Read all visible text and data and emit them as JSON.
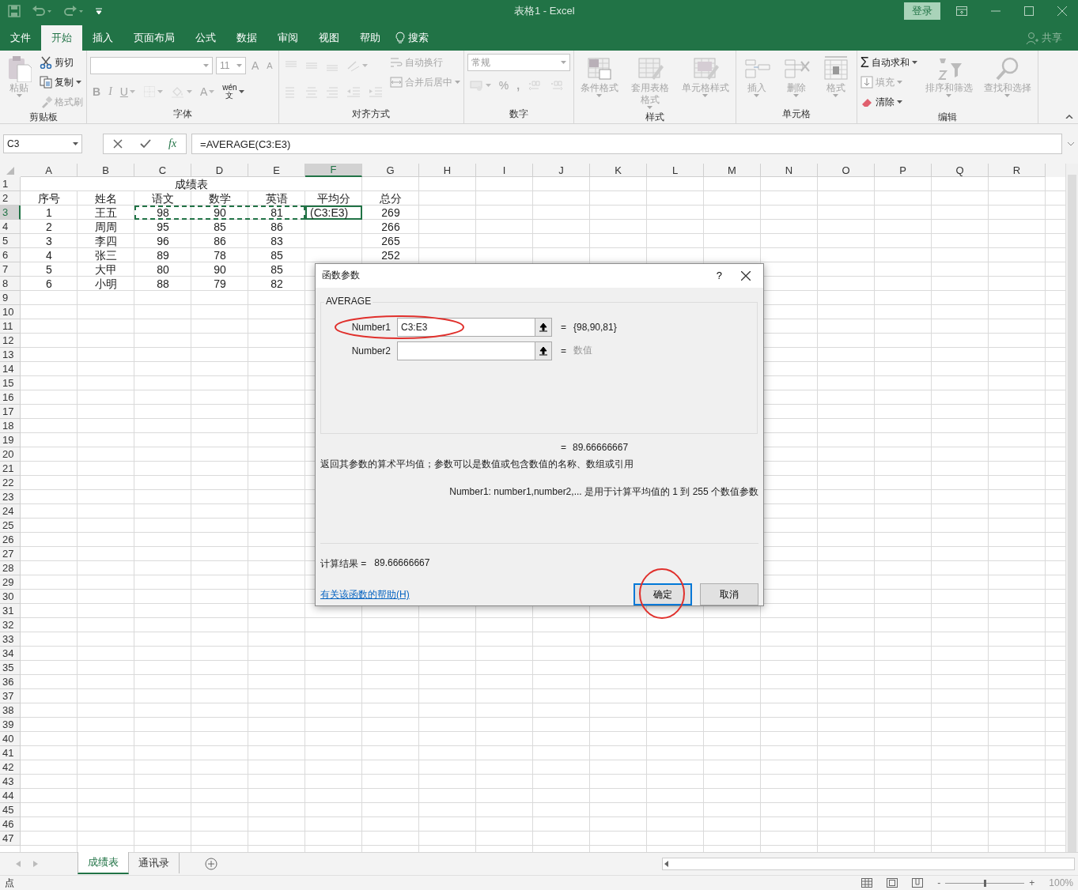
{
  "window": {
    "title": "表格1  -  Excel",
    "login_button": "登录"
  },
  "menu": {
    "tabs": [
      {
        "label": "文件",
        "selected": false
      },
      {
        "label": "开始",
        "selected": true
      },
      {
        "label": "插入",
        "selected": false
      },
      {
        "label": "页面布局",
        "selected": false
      },
      {
        "label": "公式",
        "selected": false
      },
      {
        "label": "数据",
        "selected": false
      },
      {
        "label": "审阅",
        "selected": false
      },
      {
        "label": "视图",
        "selected": false
      },
      {
        "label": "帮助",
        "selected": false
      }
    ],
    "search": "搜索",
    "share": "共享"
  },
  "ribbon": {
    "groups": [
      {
        "label": "剪贴板",
        "sections": [
          [
            {
              "kind": "large",
              "label": "粘贴",
              "disabled": true,
              "caret": true
            }
          ],
          [
            {
              "kind": "small",
              "label": "剪切",
              "disabled": false,
              "caret": false
            },
            {
              "kind": "small",
              "label": "复制",
              "disabled": false,
              "caret": true
            },
            {
              "kind": "small",
              "label": "格式刷",
              "disabled": true,
              "caret": false
            }
          ]
        ]
      },
      {
        "label": "字体",
        "sections": [
          [
            {
              "kind": "row",
              "items": [
                {
                  "kind": "combo"
                },
                {
                  "kind": "combo",
                  "value": "11"
                },
                {
                  "kind": "glyph",
                  "text": "A",
                  "disabled": true,
                  "caret": false
                },
                {
                  "kind": "glyph",
                  "text": "A",
                  "disabled": true,
                  "caret": false
                }
              ]
            },
            {
              "kind": "row",
              "items": [
                {
                  "kind": "glyph",
                  "text": "B",
                  "disabled": true,
                  "caret": false
                },
                {
                  "kind": "glyph",
                  "text": "I",
                  "disabled": true,
                  "caret": false
                },
                {
                  "kind": "glyph",
                  "text": "U",
                  "disabled": true,
                  "caret": true
                },
                {
                  "kind": "icon",
                  "disabled": true,
                  "caret": true
                },
                {
                  "kind": "icon",
                  "disabled": true,
                  "caret": true
                },
                {
                  "kind": "glyph",
                  "text": "A",
                  "disabled": true,
                  "caret": true
                },
                {
                  "kind": "glyph",
                  "text": "wén\n文",
                  "disabled": false,
                  "caret": true
                }
              ]
            }
          ]
        ]
      },
      {
        "label": "对齐方式",
        "sections": [
          [
            {
              "kind": "row",
              "items": [
                {
                  "kind": "icon",
                  "disabled": true,
                  "caret": false
                },
                {
                  "kind": "icon",
                  "disabled": true,
                  "caret": false
                },
                {
                  "kind": "icon",
                  "disabled": true,
                  "caret": false
                },
                {
                  "kind": "icon",
                  "disabled": true,
                  "caret": true
                }
              ]
            },
            {
              "kind": "row",
              "items": [
                {
                  "kind": "icon",
                  "disabled": true,
                  "caret": false
                },
                {
                  "kind": "icon",
                  "disabled": true,
                  "caret": false
                },
                {
                  "kind": "icon",
                  "disabled": true,
                  "caret": false
                },
                {
                  "kind": "icon",
                  "disabled": true,
                  "caret": false
                },
                {
                  "kind": "icon",
                  "disabled": true,
                  "caret": false
                }
              ]
            }
          ],
          [
            {
              "kind": "small",
              "label": "自动换行",
              "disabled": true,
              "caret": false
            },
            {
              "kind": "small",
              "label": "合并后居中",
              "disabled": true,
              "caret": true
            }
          ]
        ]
      },
      {
        "label": "数字",
        "sections": [
          [
            {
              "kind": "combo",
              "value": "常规"
            },
            {
              "kind": "row",
              "items": [
                {
                  "kind": "icon",
                  "disabled": true,
                  "caret": true
                },
                {
                  "kind": "glyph",
                  "text": "%",
                  "disabled": true,
                  "caret": false
                },
                {
                  "kind": "glyph",
                  "text": ",",
                  "disabled": true,
                  "caret": false
                },
                {
                  "kind": "icon",
                  "disabled": true,
                  "caret": false
                },
                {
                  "kind": "icon",
                  "disabled": true,
                  "caret": false
                }
              ]
            }
          ]
        ]
      },
      {
        "label": "样式",
        "sections": [
          [
            {
              "kind": "large",
              "label": "条件格式",
              "disabled": true,
              "caret": true
            }
          ],
          [
            {
              "kind": "large",
              "label": "套用表格格式",
              "disabled": true,
              "caret": true
            }
          ],
          [
            {
              "kind": "large",
              "label": "单元格样式",
              "disabled": true,
              "caret": true
            }
          ]
        ]
      },
      {
        "label": "单元格",
        "sections": [
          [
            {
              "kind": "large",
              "label": "插入",
              "disabled": true,
              "caret": true
            }
          ],
          [
            {
              "kind": "large",
              "label": "删除",
              "disabled": true,
              "caret": true
            }
          ],
          [
            {
              "kind": "large",
              "label": "格式",
              "disabled": true,
              "caret": true
            }
          ]
        ]
      },
      {
        "label": "编辑",
        "sections": [
          [
            {
              "kind": "small",
              "symbol": "Σ",
              "label": "自动求和",
              "disabled": false,
              "caret": true
            },
            {
              "kind": "small",
              "label": "填充",
              "disabled": true,
              "caret": true
            },
            {
              "kind": "small",
              "label": "清除",
              "disabled": false,
              "caret": true
            }
          ],
          [
            {
              "kind": "large",
              "label": "排序和筛选",
              "disabled": true,
              "caret": true
            }
          ],
          [
            {
              "kind": "large",
              "label": "查找和选择",
              "disabled": true,
              "caret": true
            }
          ]
        ]
      }
    ]
  },
  "formula_bar": {
    "name_box": "C3",
    "function_button": "fx",
    "formula": "=AVERAGE(C3:E3)"
  },
  "sheet": {
    "columns": [
      {
        "label": "A",
        "selected": false
      },
      {
        "label": "B",
        "selected": false
      },
      {
        "label": "C",
        "selected": false
      },
      {
        "label": "D",
        "selected": false
      },
      {
        "label": "E",
        "selected": false
      },
      {
        "label": "F",
        "selected": true
      },
      {
        "label": "G",
        "selected": false
      },
      {
        "label": "H",
        "selected": false
      },
      {
        "label": "I",
        "selected": false
      },
      {
        "label": "J",
        "selected": false
      },
      {
        "label": "K",
        "selected": false
      },
      {
        "label": "L",
        "selected": false
      },
      {
        "label": "M",
        "selected": false
      },
      {
        "label": "N",
        "selected": false
      },
      {
        "label": "O",
        "selected": false
      },
      {
        "label": "P",
        "selected": false
      },
      {
        "label": "Q",
        "selected": false
      },
      {
        "label": "R",
        "selected": false
      }
    ],
    "row_headers": [
      {
        "label": "1",
        "selected": false
      },
      {
        "label": "2",
        "selected": false
      },
      {
        "label": "3",
        "selected": true
      },
      {
        "label": "4",
        "selected": false
      },
      {
        "label": "5",
        "selected": false
      },
      {
        "label": "6",
        "selected": false
      },
      {
        "label": "7",
        "selected": false
      },
      {
        "label": "8",
        "selected": false
      },
      {
        "label": "9",
        "selected": false
      },
      {
        "label": "10",
        "selected": false
      },
      {
        "label": "11",
        "selected": false
      },
      {
        "label": "12",
        "selected": false
      },
      {
        "label": "13",
        "selected": false
      },
      {
        "label": "14",
        "selected": false
      },
      {
        "label": "15",
        "selected": false
      },
      {
        "label": "16",
        "selected": false
      },
      {
        "label": "17",
        "selected": false
      },
      {
        "label": "18",
        "selected": false
      },
      {
        "label": "19",
        "selected": false
      },
      {
        "label": "20",
        "selected": false
      },
      {
        "label": "21",
        "selected": false
      },
      {
        "label": "22",
        "selected": false
      },
      {
        "label": "23",
        "selected": false
      },
      {
        "label": "24",
        "selected": false
      },
      {
        "label": "25",
        "selected": false
      },
      {
        "label": "26",
        "selected": false
      },
      {
        "label": "27",
        "selected": false
      },
      {
        "label": "28",
        "selected": false
      },
      {
        "label": "29",
        "selected": false
      },
      {
        "label": "30",
        "selected": false
      },
      {
        "label": "31",
        "selected": false
      },
      {
        "label": "32",
        "selected": false
      },
      {
        "label": "33",
        "selected": false
      },
      {
        "label": "34",
        "selected": false
      },
      {
        "label": "35",
        "selected": false
      },
      {
        "label": "36",
        "selected": false
      },
      {
        "label": "37",
        "selected": false
      },
      {
        "label": "38",
        "selected": false
      },
      {
        "label": "39",
        "selected": false
      },
      {
        "label": "40",
        "selected": false
      },
      {
        "label": "41",
        "selected": false
      },
      {
        "label": "42",
        "selected": false
      },
      {
        "label": "43",
        "selected": false
      },
      {
        "label": "44",
        "selected": false
      },
      {
        "label": "45",
        "selected": false
      },
      {
        "label": "46",
        "selected": false
      },
      {
        "label": "47",
        "selected": false
      }
    ],
    "title": "成绩表",
    "header": [
      "序号",
      "姓名",
      "语文",
      "数学",
      "英语",
      "平均分",
      "总分"
    ],
    "rows": [
      {
        "cells": [
          "1",
          "王五",
          "98",
          "90",
          "81",
          "(C3:E3)",
          "269"
        ],
        "referenced": true,
        "editing": true
      },
      {
        "cells": [
          "2",
          "周周",
          "95",
          "85",
          "86",
          "",
          "266"
        ],
        "referenced": false,
        "editing": false
      },
      {
        "cells": [
          "3",
          "李四",
          "96",
          "86",
          "83",
          "",
          "265"
        ],
        "referenced": false,
        "editing": false
      },
      {
        "cells": [
          "4",
          "张三",
          "89",
          "78",
          "85",
          "",
          "252"
        ],
        "referenced": false,
        "editing": false
      },
      {
        "cells": [
          "5",
          "大甲",
          "80",
          "90",
          "85",
          "",
          ""
        ],
        "referenced": false,
        "editing": false
      },
      {
        "cells": [
          "6",
          "小明",
          "88",
          "79",
          "82",
          "",
          ""
        ],
        "referenced": false,
        "editing": false
      }
    ]
  },
  "dialog": {
    "title": "函数参数",
    "help_button": "?",
    "function_name": "AVERAGE",
    "args": [
      {
        "label": "Number1",
        "value": "C3:E3",
        "eq": "=",
        "result": "{98,90,81}",
        "result_hint": false,
        "circled": true
      },
      {
        "label": "Number2",
        "eq": "=",
        "result": "数值",
        "result_hint": true,
        "circled": false
      }
    ],
    "formula_result": {
      "eq": "=",
      "value": "89.66666667"
    },
    "description": "返回其参数的算术平均值；参数可以是数值或包含数值的名称、数组或引用",
    "arg_help": "Number1:  number1,number2,... 是用于计算平均值的 1 到 255 个数值参数",
    "result_label": "计算结果 =",
    "result_value": "89.66666667",
    "help_link": "有关该函数的帮助(H)",
    "buttons": [
      {
        "label": "确定",
        "default": true,
        "circled": true
      },
      {
        "label": "取消",
        "default": false,
        "circled": false
      }
    ]
  },
  "sheet_tabs": [
    {
      "label": "成绩表",
      "selected": true
    },
    {
      "label": "通讯录",
      "selected": false
    }
  ],
  "status_bar": {
    "mode": "点",
    "zoom_out": "-",
    "zoom_in": "+",
    "zoom": {
      "level": 0.5
    },
    "zoom_text": "100%"
  }
}
